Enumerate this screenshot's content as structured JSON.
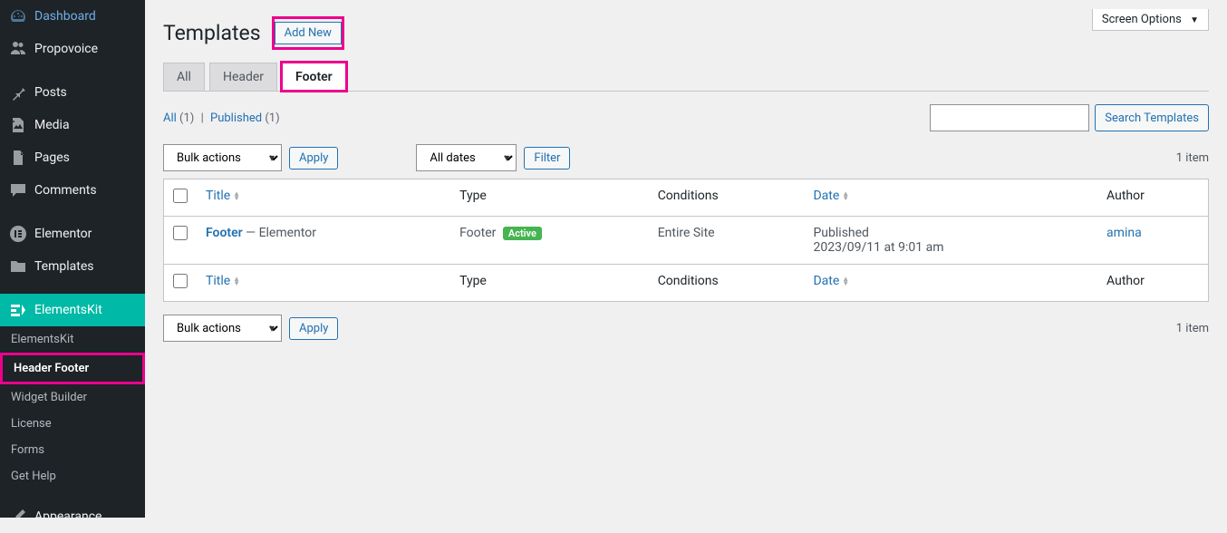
{
  "screen_options": "Screen Options",
  "page_title": "Templates",
  "add_new": "Add New",
  "sidebar": {
    "items": [
      {
        "label": "Dashboard",
        "icon": "dashboard"
      },
      {
        "label": "Propovoice",
        "icon": "users"
      },
      {
        "label": "Posts",
        "icon": "pin"
      },
      {
        "label": "Media",
        "icon": "media"
      },
      {
        "label": "Pages",
        "icon": "pages"
      },
      {
        "label": "Comments",
        "icon": "comment"
      },
      {
        "label": "Elementor",
        "icon": "elementor"
      },
      {
        "label": "Templates",
        "icon": "folder"
      },
      {
        "label": "ElementsKit",
        "icon": "ekit"
      },
      {
        "label": "Appearance",
        "icon": "brush"
      }
    ],
    "subitems": [
      {
        "label": "ElementsKit"
      },
      {
        "label": "Header Footer"
      },
      {
        "label": "Widget Builder"
      },
      {
        "label": "License"
      },
      {
        "label": "Forms"
      },
      {
        "label": "Get Help"
      }
    ]
  },
  "tabs": [
    {
      "label": "All"
    },
    {
      "label": "Header"
    },
    {
      "label": "Footer"
    }
  ],
  "filter_links": {
    "all_label": "All",
    "all_count": "(1)",
    "pub_label": "Published",
    "pub_count": "(1)"
  },
  "search_btn": "Search Templates",
  "bulk_actions": "Bulk actions",
  "apply": "Apply",
  "all_dates": "All dates",
  "filter": "Filter",
  "item_count": "1 item",
  "columns": {
    "title": "Title",
    "type": "Type",
    "conditions": "Conditions",
    "date": "Date",
    "author": "Author"
  },
  "rows": [
    {
      "title": "Footer",
      "title_suffix": " — Elementor",
      "type": "Footer",
      "active": "Active",
      "conditions": "Entire Site",
      "date_status": "Published",
      "date_value": "2023/09/11 at 9:01 am",
      "author": "amina"
    }
  ]
}
